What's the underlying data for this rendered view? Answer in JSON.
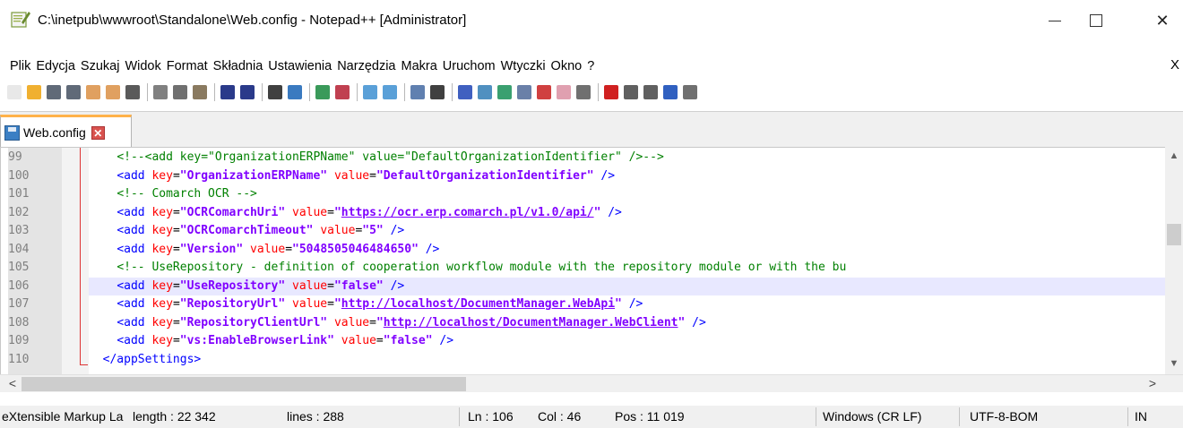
{
  "window": {
    "title": "C:\\inetpub\\wwwroot\\Standalone\\Web.config - Notepad++ [Administrator]",
    "app_icon": "notepadpp-icon",
    "controls": {
      "minimize": "minimize-icon",
      "maximize": "maximize-icon",
      "close": "✕"
    }
  },
  "menu": {
    "items": [
      "Plik",
      "Edycja",
      "Szukaj",
      "Widok",
      "Format",
      "Składnia",
      "Ustawienia",
      "Narzędzia",
      "Makra",
      "Uruchom",
      "Wtyczki",
      "Okno",
      "?"
    ],
    "close_doc": "X"
  },
  "toolbar": {
    "icons": [
      {
        "name": "new-file-icon",
        "color": "#e8e8e8"
      },
      {
        "name": "open-file-icon",
        "color": "#f0b030"
      },
      {
        "name": "save-icon",
        "color": "#606a78"
      },
      {
        "name": "save-all-icon",
        "color": "#606a78"
      },
      {
        "name": "close-icon",
        "color": "#e0a060"
      },
      {
        "name": "close-all-icon",
        "color": "#e0a060"
      },
      {
        "name": "print-icon",
        "color": "#5a5a5a"
      },
      {
        "name": "sep"
      },
      {
        "name": "cut-icon",
        "color": "#808080"
      },
      {
        "name": "copy-icon",
        "color": "#707070"
      },
      {
        "name": "paste-icon",
        "color": "#8a7a60"
      },
      {
        "name": "sep"
      },
      {
        "name": "undo-icon",
        "color": "#2a3a8a"
      },
      {
        "name": "redo-icon",
        "color": "#2a3a8a"
      },
      {
        "name": "sep"
      },
      {
        "name": "find-icon",
        "color": "#404040"
      },
      {
        "name": "replace-icon",
        "color": "#3a7ac0"
      },
      {
        "name": "sep"
      },
      {
        "name": "zoom-in-icon",
        "color": "#3a9a5a"
      },
      {
        "name": "zoom-out-icon",
        "color": "#c04050"
      },
      {
        "name": "sep"
      },
      {
        "name": "sync-vertical-icon",
        "color": "#5aa0d8"
      },
      {
        "name": "sync-horizontal-icon",
        "color": "#5aa0d8"
      },
      {
        "name": "sep"
      },
      {
        "name": "word-wrap-icon",
        "color": "#6080b0"
      },
      {
        "name": "show-all-chars-icon",
        "color": "#404040"
      },
      {
        "name": "sep"
      },
      {
        "name": "indent-guide-icon",
        "color": "#4060c0"
      },
      {
        "name": "udl-icon",
        "color": "#5090c0"
      },
      {
        "name": "doc-map-icon",
        "color": "#3aa070"
      },
      {
        "name": "function-list-icon",
        "color": "#6a80a8"
      },
      {
        "name": "folder-workspace-icon",
        "color": "#d04040"
      },
      {
        "name": "doc-list-icon",
        "color": "#e0a0b0"
      },
      {
        "name": "monitoring-icon",
        "color": "#707070"
      },
      {
        "name": "sep"
      },
      {
        "name": "record-macro-icon",
        "color": "#d02020"
      },
      {
        "name": "stop-macro-icon",
        "color": "#606060"
      },
      {
        "name": "play-macro-icon",
        "color": "#606060"
      },
      {
        "name": "run-macro-multiple-icon",
        "color": "#3060c0"
      },
      {
        "name": "save-macro-icon",
        "color": "#707070"
      }
    ]
  },
  "tab": {
    "label": "Web.config",
    "close": "✕",
    "accent": "#ffb24a"
  },
  "editor": {
    "current_line": 106,
    "lines": [
      {
        "n": "99",
        "tokens": [
          {
            "c": "plain",
            "t": "    "
          },
          {
            "c": "cmt",
            "t": "<!--<add key=\"OrganizationERPName\" value=\"DefaultOrganizationIdentifier\" />-->"
          }
        ]
      },
      {
        "n": "100",
        "tokens": [
          {
            "c": "plain",
            "t": "    "
          },
          {
            "c": "tag",
            "t": "<add "
          },
          {
            "c": "attr",
            "t": "key"
          },
          {
            "c": "plain",
            "t": "="
          },
          {
            "c": "val",
            "t": "\"OrganizationERPName\""
          },
          {
            "c": "plain",
            "t": " "
          },
          {
            "c": "attr",
            "t": "value"
          },
          {
            "c": "plain",
            "t": "="
          },
          {
            "c": "val",
            "t": "\"DefaultOrganizationIdentifier\""
          },
          {
            "c": "tag",
            "t": " />"
          }
        ]
      },
      {
        "n": "101",
        "tokens": [
          {
            "c": "plain",
            "t": "    "
          },
          {
            "c": "cmt",
            "t": "<!-- Comarch OCR -->"
          }
        ]
      },
      {
        "n": "102",
        "tokens": [
          {
            "c": "plain",
            "t": "    "
          },
          {
            "c": "tag",
            "t": "<add "
          },
          {
            "c": "attr",
            "t": "key"
          },
          {
            "c": "plain",
            "t": "="
          },
          {
            "c": "val",
            "t": "\"OCRComarchUri\""
          },
          {
            "c": "plain",
            "t": " "
          },
          {
            "c": "attr",
            "t": "value"
          },
          {
            "c": "plain",
            "t": "="
          },
          {
            "c": "val",
            "t": "\""
          },
          {
            "c": "url",
            "t": "https://ocr.erp.comarch.pl/v1.0/api/"
          },
          {
            "c": "val",
            "t": "\""
          },
          {
            "c": "tag",
            "t": " />"
          }
        ]
      },
      {
        "n": "103",
        "tokens": [
          {
            "c": "plain",
            "t": "    "
          },
          {
            "c": "tag",
            "t": "<add "
          },
          {
            "c": "attr",
            "t": "key"
          },
          {
            "c": "plain",
            "t": "="
          },
          {
            "c": "val",
            "t": "\"OCRComarchTimeout\""
          },
          {
            "c": "plain",
            "t": " "
          },
          {
            "c": "attr",
            "t": "value"
          },
          {
            "c": "plain",
            "t": "="
          },
          {
            "c": "val",
            "t": "\"5\""
          },
          {
            "c": "tag",
            "t": " />"
          }
        ]
      },
      {
        "n": "104",
        "tokens": [
          {
            "c": "plain",
            "t": "    "
          },
          {
            "c": "tag",
            "t": "<add "
          },
          {
            "c": "attr",
            "t": "key"
          },
          {
            "c": "plain",
            "t": "="
          },
          {
            "c": "val",
            "t": "\"Version\""
          },
          {
            "c": "plain",
            "t": " "
          },
          {
            "c": "attr",
            "t": "value"
          },
          {
            "c": "plain",
            "t": "="
          },
          {
            "c": "val",
            "t": "\"5048505046484650\""
          },
          {
            "c": "tag",
            "t": " />"
          }
        ]
      },
      {
        "n": "105",
        "tokens": [
          {
            "c": "plain",
            "t": "    "
          },
          {
            "c": "cmt",
            "t": "<!-- UseRepository - definition of cooperation workflow module with the repository module or with the bu"
          }
        ]
      },
      {
        "n": "106",
        "tokens": [
          {
            "c": "plain",
            "t": "    "
          },
          {
            "c": "tag",
            "t": "<add "
          },
          {
            "c": "attr",
            "t": "key"
          },
          {
            "c": "plain",
            "t": "="
          },
          {
            "c": "val",
            "t": "\"UseRepository\""
          },
          {
            "c": "plain",
            "t": " "
          },
          {
            "c": "attr",
            "t": "value"
          },
          {
            "c": "plain",
            "t": "="
          },
          {
            "c": "val",
            "t": "\"false\""
          },
          {
            "c": "tag",
            "t": " />"
          }
        ]
      },
      {
        "n": "107",
        "tokens": [
          {
            "c": "plain",
            "t": "    "
          },
          {
            "c": "tag",
            "t": "<add "
          },
          {
            "c": "attr",
            "t": "key"
          },
          {
            "c": "plain",
            "t": "="
          },
          {
            "c": "val",
            "t": "\"RepositoryUrl\""
          },
          {
            "c": "plain",
            "t": " "
          },
          {
            "c": "attr",
            "t": "value"
          },
          {
            "c": "plain",
            "t": "="
          },
          {
            "c": "val",
            "t": "\""
          },
          {
            "c": "url",
            "t": "http://localhost/DocumentManager.WebApi"
          },
          {
            "c": "val",
            "t": "\""
          },
          {
            "c": "tag",
            "t": " />"
          }
        ]
      },
      {
        "n": "108",
        "tokens": [
          {
            "c": "plain",
            "t": "    "
          },
          {
            "c": "tag",
            "t": "<add "
          },
          {
            "c": "attr",
            "t": "key"
          },
          {
            "c": "plain",
            "t": "="
          },
          {
            "c": "val",
            "t": "\"RepositoryClientUrl\""
          },
          {
            "c": "plain",
            "t": " "
          },
          {
            "c": "attr",
            "t": "value"
          },
          {
            "c": "plain",
            "t": "="
          },
          {
            "c": "val",
            "t": "\""
          },
          {
            "c": "url",
            "t": "http://localhost/DocumentManager.WebClient"
          },
          {
            "c": "val",
            "t": "\""
          },
          {
            "c": "tag",
            "t": " />"
          }
        ]
      },
      {
        "n": "109",
        "tokens": [
          {
            "c": "plain",
            "t": "    "
          },
          {
            "c": "tag",
            "t": "<add "
          },
          {
            "c": "attr",
            "t": "key"
          },
          {
            "c": "plain",
            "t": "="
          },
          {
            "c": "val",
            "t": "\"vs:EnableBrowserLink\""
          },
          {
            "c": "plain",
            "t": " "
          },
          {
            "c": "attr",
            "t": "value"
          },
          {
            "c": "plain",
            "t": "="
          },
          {
            "c": "val",
            "t": "\"false\""
          },
          {
            "c": "tag",
            "t": " />"
          }
        ]
      },
      {
        "n": "110",
        "tokens": [
          {
            "c": "plain",
            "t": "  "
          },
          {
            "c": "tag",
            "t": "</appSettings>"
          }
        ]
      }
    ]
  },
  "scrollbars": {
    "up": "▲",
    "down": "▼",
    "left": "<",
    "right": ">"
  },
  "status": {
    "language": "eXtensible Markup La",
    "length": "length : 22 342",
    "lines": "lines : 288",
    "ln": "Ln : 106",
    "col": "Col : 46",
    "pos": "Pos : 11 019",
    "eol": "Windows (CR LF)",
    "encoding": "UTF-8-BOM",
    "mode": "IN"
  }
}
